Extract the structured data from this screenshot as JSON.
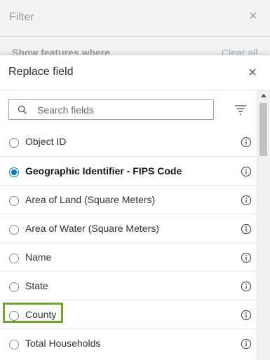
{
  "filter_panel": {
    "title": "Filter",
    "show_features_label": "Show features where",
    "clear_all_label": "Clear all"
  },
  "replace_field": {
    "title": "Replace field",
    "search": {
      "placeholder": "Search fields",
      "value": ""
    },
    "fields": [
      {
        "label": "Object ID",
        "selected": false
      },
      {
        "label": "Geographic Identifier - FIPS Code",
        "selected": true
      },
      {
        "label": "Area of Land (Square Meters)",
        "selected": false
      },
      {
        "label": "Area of Water (Square Meters)",
        "selected": false
      },
      {
        "label": "Name",
        "selected": false
      },
      {
        "label": "State",
        "selected": false
      },
      {
        "label": "County",
        "selected": false,
        "highlighted": true
      },
      {
        "label": "Total Households",
        "selected": false
      }
    ]
  },
  "colors": {
    "accent": "#007ac2",
    "highlight": "#6fa430"
  },
  "icons": {
    "close": "close-icon",
    "search": "search-icon",
    "sort": "sort-icon",
    "info": "info-icon"
  }
}
